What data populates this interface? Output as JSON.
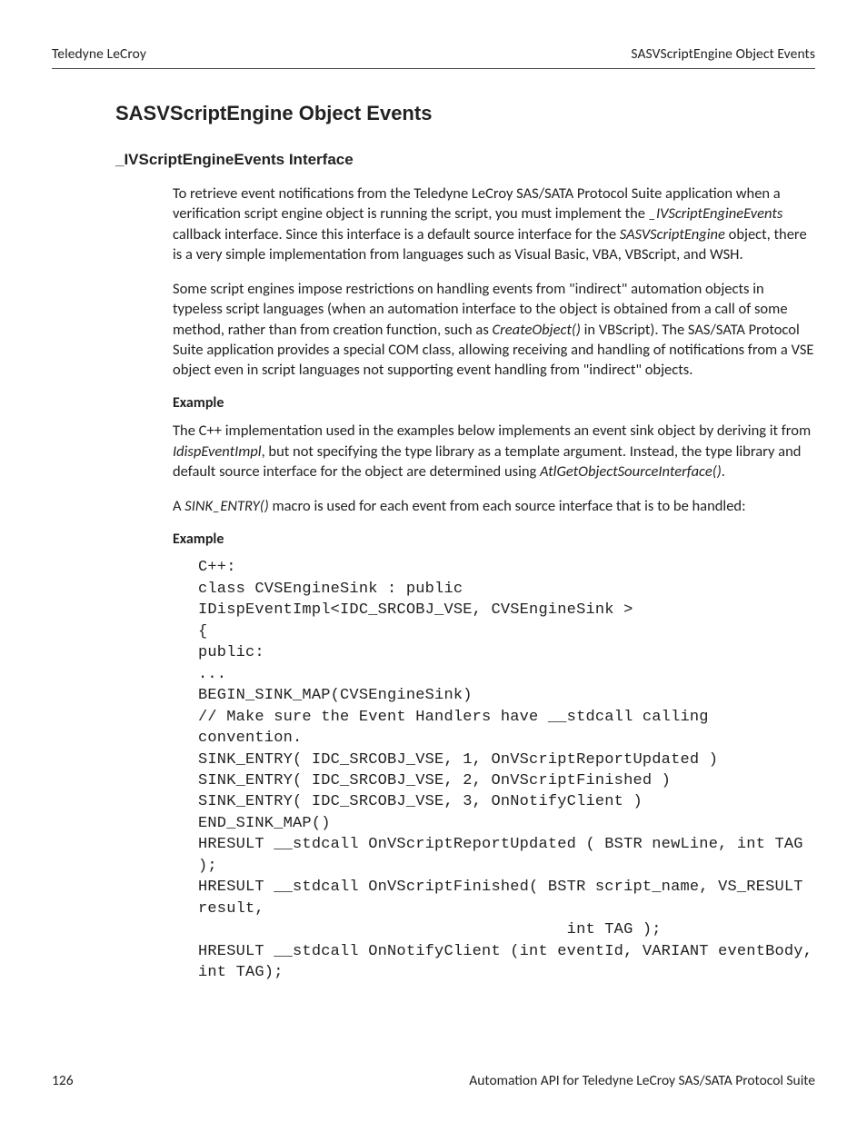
{
  "header": {
    "left": "Teledyne LeCroy",
    "right": "SASVScriptEngine Object Events"
  },
  "title": "SASVScriptEngine Object Events",
  "subsection": "_IVScriptEngineEvents Interface",
  "para1_a": "To retrieve event notifications from the Teledyne LeCroy SAS/SATA Protocol Suite application when a verification script engine object is running the script, you must implement the ",
  "para1_i1": "_IVScriptEngineEvents",
  "para1_b": " callback interface. Since this interface is a default source interface for the ",
  "para1_i2": "SASVScriptEngine",
  "para1_c": " object, there is a very simple implementation from languages such as Visual Basic, VBA, VBScript, and WSH.",
  "para2_a": "Some script engines impose restrictions on handling events from \"indirect\" automation objects in typeless script languages (when an automation interface to the object is obtained from a call of some method, rather than from creation function, such as ",
  "para2_i1": "CreateObject()",
  "para2_b": " in VBScript). The SAS/SATA Protocol Suite application provides a special COM class, allowing receiving and handling of notifications from a VSE object even in script languages not supporting event handling from \"indirect\" objects.",
  "example_label": "Example",
  "para3_a": "The C++ implementation used in the examples below implements an event sink object by deriving it from ",
  "para3_i1": "IdispEventImpl",
  "para3_b": ", but not specifying the type library as a template argument. Instead, the type library and default source interface for the object are determined using ",
  "para3_i2": "AtlGetObjectSourceInterface()",
  "para3_c": ".",
  "para4_a": "A ",
  "para4_i1": "SINK_ENTRY()",
  "para4_b": " macro is used for each event from each source interface that is to be handled:",
  "example_label2": "Example",
  "code": "C++:\nclass CVSEngineSink : public\nIDispEventImpl<IDC_SRCOBJ_VSE, CVSEngineSink >\n{\npublic:\n...\nBEGIN_SINK_MAP(CVSEngineSink)\n// Make sure the Event Handlers have __stdcall calling convention.\nSINK_ENTRY( IDC_SRCOBJ_VSE, 1, OnVScriptReportUpdated ) \nSINK_ENTRY( IDC_SRCOBJ_VSE, 2, OnVScriptFinished ) \nSINK_ENTRY( IDC_SRCOBJ_VSE, 3, OnNotifyClient )\nEND_SINK_MAP()\nHRESULT __stdcall OnVScriptReportUpdated ( BSTR newLine, int TAG );\nHRESULT __stdcall OnVScriptFinished( BSTR script_name, VS_RESULT result, \n                                       int TAG );\nHRESULT __stdcall OnNotifyClient (int eventId, VARIANT eventBody, int TAG);",
  "footer": {
    "page": "126",
    "right": "Automation API for Teledyne LeCroy SAS/SATA Protocol Suite"
  }
}
